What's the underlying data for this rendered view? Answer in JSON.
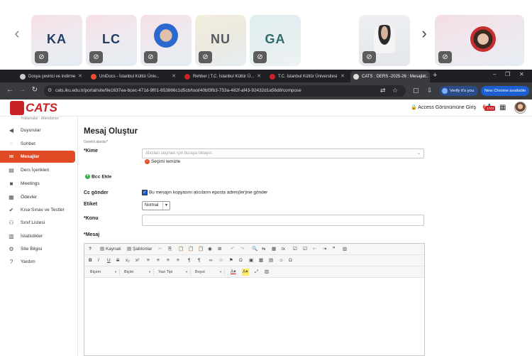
{
  "meeting": {
    "participants": [
      {
        "initials": "KA",
        "color": "#1f3d66"
      },
      {
        "initials": "LC",
        "color": "#1f3d66"
      },
      {
        "initials": "",
        "color": "#2a6ad0"
      },
      {
        "initials": "NU",
        "color": "#555a62"
      },
      {
        "initials": "GA",
        "color": "#2f6b6a"
      },
      {
        "initials": "",
        "color": "#a8bcd0"
      },
      {
        "initials": "",
        "color": "#3a3a3a"
      },
      {
        "initials": "",
        "color": "#c83030"
      }
    ]
  },
  "browser": {
    "tabs": [
      {
        "label": "Dosya çevirici ve indirme",
        "fav": "#cccccc"
      },
      {
        "label": "UniDocs - İstanbul Kültür Üniv...",
        "fav": "#e85030"
      },
      {
        "label": "Rehber | T.C. İstanbul Kültür Ü...",
        "fav": "#c82128"
      },
      {
        "label": "T.C. İstanbul Kültür Üniversitesi",
        "fav": "#c82128"
      },
      {
        "label": "CATS : DERS -2025-26 : Mesajla...",
        "fav": "#dddddd"
      }
    ],
    "url": "cats.iku.edu.tr/portal/site/9e1637ea-bcec-471d-9f01-653866c1d5cb/tool/40bf3fb3-753a-482f-af43-92432d1a56d8/compose",
    "verify_label": "Verify it's you",
    "new_chrome_label": "New Chrome available"
  },
  "header": {
    "logo_text": "CATS",
    "access_label": "Access Görünümüne Giriş",
    "notification_count": "1743"
  },
  "sidebar": {
    "cut_label": "Yoklamalar - Attendance",
    "items": [
      {
        "label": "Duyurular",
        "icon": "megaphone-icon",
        "glyph": "◀"
      },
      {
        "label": "Sohbet",
        "icon": "chat-icon",
        "glyph": "💬"
      },
      {
        "label": "Mesajlar",
        "icon": "inbox-icon",
        "glyph": "✉"
      },
      {
        "label": "Ders İçerikleri",
        "icon": "document-icon",
        "glyph": "▤"
      },
      {
        "label": "Meetings",
        "icon": "video-icon",
        "glyph": "■"
      },
      {
        "label": "Ödevler",
        "icon": "assignment-icon",
        "glyph": "▦"
      },
      {
        "label": "Kısa Sınav ve Testler",
        "icon": "quiz-icon",
        "glyph": "✔"
      },
      {
        "label": "Sınıf Listesi",
        "icon": "users-icon",
        "glyph": "👥"
      },
      {
        "label": "İstatistikler",
        "icon": "stats-icon",
        "glyph": "📊"
      },
      {
        "label": "Site Bilgisi",
        "icon": "gear-icon",
        "glyph": "⚙"
      },
      {
        "label": "Yardım",
        "icon": "help-icon",
        "glyph": "?"
      }
    ]
  },
  "compose": {
    "title": "Mesaj Oluştur",
    "required_note": "Gerekli alanlar*",
    "to_label": "*Kime",
    "to_placeholder": "Alıcıları seçmek için buraya tıklayın.",
    "clear_label": "Seçimi temizle",
    "bcc_label": "Bcc Ekle",
    "cc_label": "Cc gönder",
    "cc_text": "Bu mesajın kopyasını alıcıların eposta adres(ler)ine gönder",
    "tag_label": "Etiket",
    "tag_value": "Normal",
    "subject_label": "*Konu",
    "message_label": "*Mesaj"
  },
  "editor": {
    "row1": [
      "?",
      "Kaynak",
      "Şablonlar",
      "✂",
      "⎘",
      "📋",
      "📋",
      "📋",
      "◉",
      "⊞",
      "↶",
      "↷",
      "🔍",
      "⇆",
      "▦",
      "Ix",
      "☑",
      "☑",
      "⇤",
      "⇥",
      "❞",
      "▥"
    ],
    "row2": [
      "B",
      "I",
      "U",
      "S",
      "x₂",
      "x²",
      "≡",
      "≡",
      "≡",
      "≡",
      "¶",
      "¶",
      "∞",
      "⊘",
      "⚑",
      "Ω",
      "▣",
      "▦",
      "▤",
      "☺",
      "Ω"
    ],
    "combos": [
      "Biçem",
      "Biçim",
      "Yazı Tipi",
      "Boyut"
    ],
    "row3_tail": [
      "A",
      "A",
      "⤢",
      "▥"
    ]
  }
}
